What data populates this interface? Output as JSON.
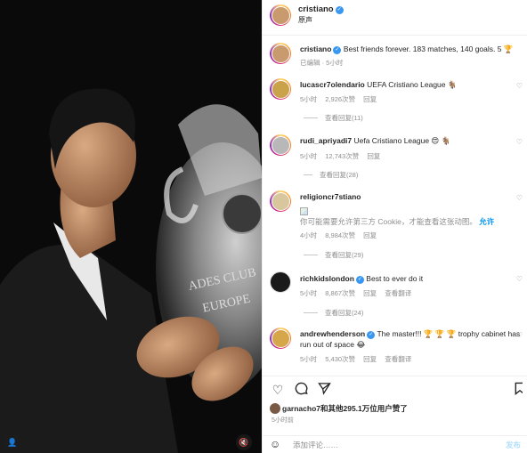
{
  "post": {
    "username": "cristiano",
    "subtitle": "原声",
    "caption": "Best friends forever. 183 matches, 140 goals. 5 🏆",
    "caption_meta": "已编辑 · 5小时"
  },
  "comments": [
    {
      "username": "lucascr7olendario",
      "text": "UEFA Cristiano League 🐐",
      "time": "5小时",
      "likes": "2,926次赞",
      "reply": "回复",
      "view_replies": "查看回复(11)",
      "verified": false,
      "avatar_color": "#c9a24a"
    },
    {
      "username": "rudi_apriyadi7",
      "text": "Uefa Cristiano League 😍 🐐",
      "time": "5小时",
      "likes": "12,743次赞",
      "reply": "回复",
      "view_replies": "查看回复(28)",
      "verified": false,
      "avatar_color": "#b8b8b8"
    },
    {
      "username": "religioncr7stiano",
      "text": "你可能需要允许第三方 Cookie，才能查看这张动图。",
      "allow": "允许",
      "time": "4小时",
      "likes": "8,984次赞",
      "reply": "回复",
      "view_replies": "查看回复(29)",
      "verified": false,
      "avatar_color": "#d8c79c"
    },
    {
      "username": "richkidslondon",
      "text": "Best to ever do it",
      "time": "5小时",
      "likes": "8,867次赞",
      "reply": "回复",
      "translate": "查看翻译",
      "view_replies": "查看回复(24)",
      "verified": true,
      "avatar_color": "#1a1a1a"
    },
    {
      "username": "andrewhenderson",
      "text": "The master!!! 🏆 🏆 🏆 trophy cabinet has run out of space 😂",
      "time": "5小时",
      "likes": "5,430次赞",
      "reply": "回复",
      "translate": "查看翻译",
      "verified": true,
      "avatar_color": "#d6a64a"
    }
  ],
  "likes": {
    "text_user": "garnacho7",
    "text_rest": "和其他295.1万位用户赞了"
  },
  "time_ago": "5小时前",
  "comment_input": {
    "placeholder": "添加评论……",
    "post_label": "发布"
  },
  "icons": [
    "heart-icon",
    "comment-icon",
    "share-icon",
    "bookmark-icon",
    "smile-icon",
    "user-tag-icon",
    "sound-off-icon",
    "verified-icon"
  ]
}
